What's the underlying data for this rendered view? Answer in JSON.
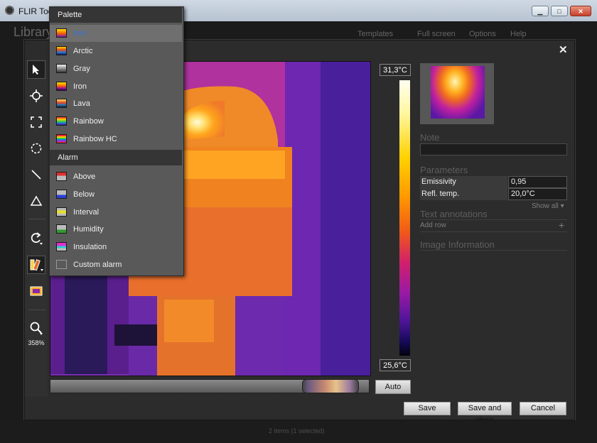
{
  "window": {
    "title": "FLIR Tools"
  },
  "background": {
    "library_label": "Library",
    "menu_items": [
      "Templates",
      "Full screen",
      "Options",
      "Help"
    ],
    "status": "2 items  (1 selected)"
  },
  "toolbar": {
    "zoom": "358%"
  },
  "scale": {
    "max": "31,3°C",
    "min": "25,6°C"
  },
  "auto_label": "Auto",
  "right_panel": {
    "note_title": "Note",
    "parameters_title": "Parameters",
    "parameters": [
      {
        "label": "Emissivity",
        "value": "0,95"
      },
      {
        "label": "Refl. temp.",
        "value": "20,0°C"
      }
    ],
    "show_all": "Show all",
    "text_annotations_title": "Text annotations",
    "add_row": "Add row",
    "image_info_title": "Image Information"
  },
  "footer": {
    "save": "Save",
    "save_close": "Save and close",
    "cancel": "Cancel"
  },
  "menu": {
    "palette_header": "Palette",
    "palette_items": [
      {
        "label": "Iron",
        "colors": "#222",
        "selected": true
      },
      {
        "label": "Arctic",
        "colors": "",
        "selected": false
      },
      {
        "label": "Gray",
        "colors": "",
        "selected": false
      },
      {
        "label": "Iron",
        "colors": "",
        "selected": false
      },
      {
        "label": "Lava",
        "colors": "",
        "selected": false
      },
      {
        "label": "Rainbow",
        "colors": "",
        "selected": false
      },
      {
        "label": "Rainbow HC",
        "colors": "",
        "selected": false
      }
    ],
    "alarm_header": "Alarm",
    "alarm_items": [
      {
        "label": "Above",
        "color": "#e03030"
      },
      {
        "label": "Below",
        "color": "#2b3fd6"
      },
      {
        "label": "Interval",
        "color": "#e8e020"
      },
      {
        "label": "Humidity",
        "color": "#2f9a2f"
      },
      {
        "label": "Insulation",
        "color": "#e02fd0"
      },
      {
        "label": "Custom alarm",
        "color": "#5a5a5a"
      }
    ]
  }
}
